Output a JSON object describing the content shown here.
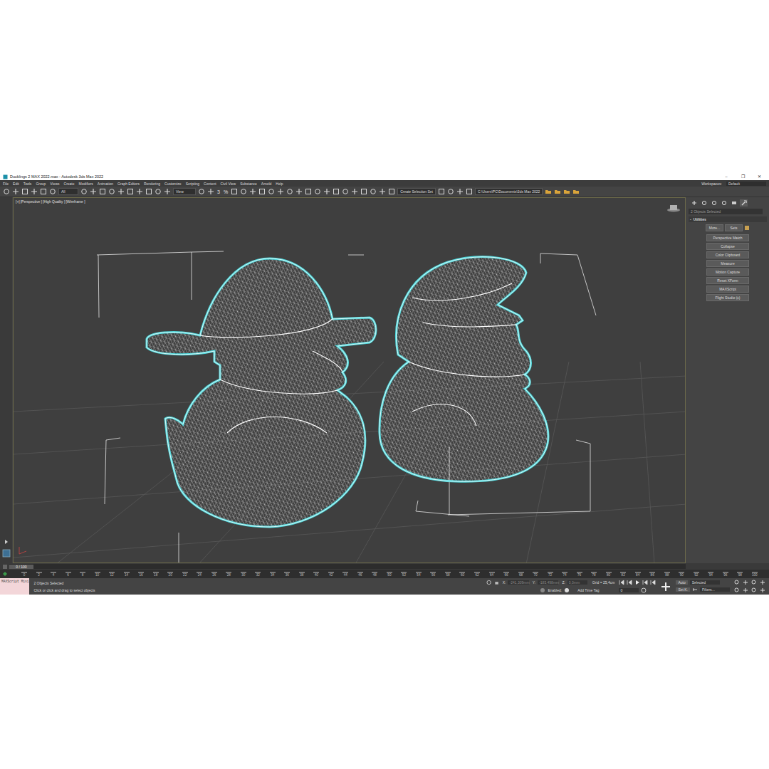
{
  "window": {
    "title": "Ducklings 2 MAX 2022.max - Autodesk 3ds Max 2022",
    "controls": [
      "–",
      "❐",
      "✕"
    ]
  },
  "menu": {
    "items": [
      "File",
      "Edit",
      "Tools",
      "Group",
      "Views",
      "Create",
      "Modifiers",
      "Animation",
      "Graph Editors",
      "Rendering",
      "Customize",
      "Scripting",
      "Content",
      "Civil View",
      "Substance",
      "Arnold",
      "Help"
    ],
    "workspaces_label": "Workspaces:",
    "workspace": "Default"
  },
  "toolbar": {
    "selection_filter": "All",
    "reference_coord": "View",
    "snaps": [
      "3",
      "%"
    ],
    "selection_set": "Create Selection Set",
    "project_path": "C:\\Users\\PC\\Documents\\3ds Max 2022"
  },
  "viewport": {
    "labels": [
      "[+]",
      "[Perspective ]",
      "[High Quality ]",
      "[Wireframe ]"
    ],
    "objects": [
      {
        "kind": "bicorne",
        "selected": true
      },
      {
        "kind": "cap",
        "selected": true
      }
    ]
  },
  "command_panel": {
    "tabs": [
      {
        "selected": false
      },
      {
        "selected": false
      },
      {
        "selected": false
      },
      {
        "selected": false
      },
      {
        "selected": false
      },
      {
        "selected": true
      }
    ],
    "field": "2 Objects Selected",
    "rollout": {
      "title": "Utilities",
      "expanded": true,
      "marker": "-",
      "top_buttons": [
        "More...",
        "Sets"
      ],
      "buttons": [
        "Perspective Match",
        "Collapse",
        "Color Clipboard",
        "Measure",
        "Motion Capture",
        "Reset XForm",
        "MAXScript",
        "Flight Studio (c)"
      ]
    }
  },
  "timeline": {
    "frame": "0 / 100",
    "level": 0,
    "ticks": [
      "0",
      "2",
      "4",
      "6",
      "8",
      "10",
      "12",
      "14",
      "16",
      "18",
      "20",
      "22",
      "24",
      "26",
      "28",
      "30",
      "32",
      "34",
      "36",
      "38",
      "40",
      "42",
      "44",
      "46",
      "48",
      "50",
      "52",
      "54",
      "56",
      "58",
      "60",
      "62",
      "64",
      "66",
      "68",
      "70",
      "72",
      "74",
      "76",
      "78",
      "80",
      "82",
      "84",
      "86",
      "88",
      "90",
      "92",
      "94",
      "96",
      "98",
      "100"
    ]
  },
  "status_bar": {
    "maxscript": "MAXScript Mini",
    "selection": "2 Objects Selected",
    "prompt": "Click or click and drag to select objects",
    "coords": [
      {
        "label": "X:",
        "value": "-241,309mm"
      },
      {
        "label": "Y:",
        "value": "-185,498mm"
      },
      {
        "label": "Z:",
        "value": "0,0mm"
      }
    ],
    "grid": "Grid = 25,4cm",
    "enabled": "Enabled:",
    "add_time_tag": "Add Time Tag",
    "key_mode": "Auto",
    "key_filter": "Selected",
    "set_key": "Set K.",
    "filters": "Filters...",
    "current_frame": "0"
  }
}
